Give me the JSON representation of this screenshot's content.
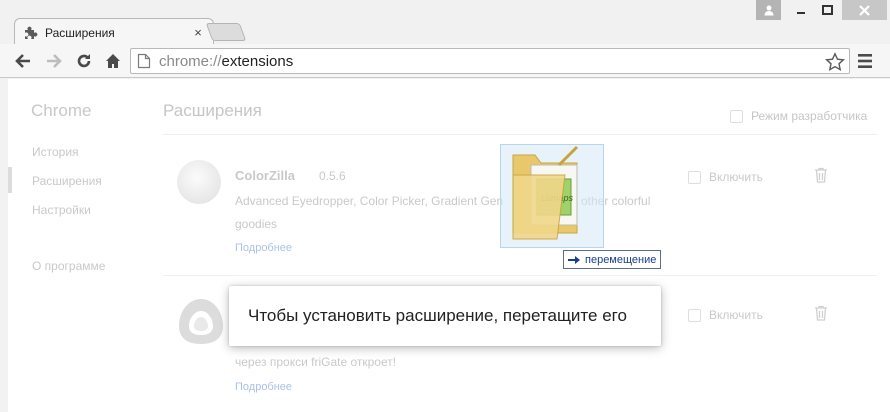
{
  "window": {
    "tab_title": "Расширения",
    "tab_close": "×",
    "controls": {
      "user": "user-icon",
      "minimize": "minimize-icon",
      "maximize": "maximize-icon",
      "close": "close-icon"
    }
  },
  "toolbar": {
    "url_scheme": "chrome://",
    "url_host": "extensions"
  },
  "sidebar": {
    "title": "Chrome",
    "items": [
      {
        "label": "История"
      },
      {
        "label": "Расширения"
      },
      {
        "label": "Настройки"
      },
      {
        "label": "О программе"
      }
    ]
  },
  "main": {
    "title": "Расширения",
    "dev_mode_label": "Режим разработчика",
    "extensions": [
      {
        "name": "ColorZilla",
        "version": "0.5.6",
        "desc_line1": "Advanced Eyedropper, Color Picker, Gradient Gen",
        "desc_line1_tail": "other colorful",
        "desc_line2": "goodies",
        "link": "Подробнее",
        "enable_label": "Включить"
      },
      {
        "name": "",
        "desc_line2": "через прокси friGate откроет!",
        "link": "Подробнее",
        "enable_label": "Включить"
      }
    ]
  },
  "drag": {
    "tooltip": "перемещение"
  },
  "drop_message": "Чтобы установить расширение, перетащите его",
  "colors": {
    "accent_link": "#1a3d8f",
    "window_close": "#c7c7c7"
  }
}
